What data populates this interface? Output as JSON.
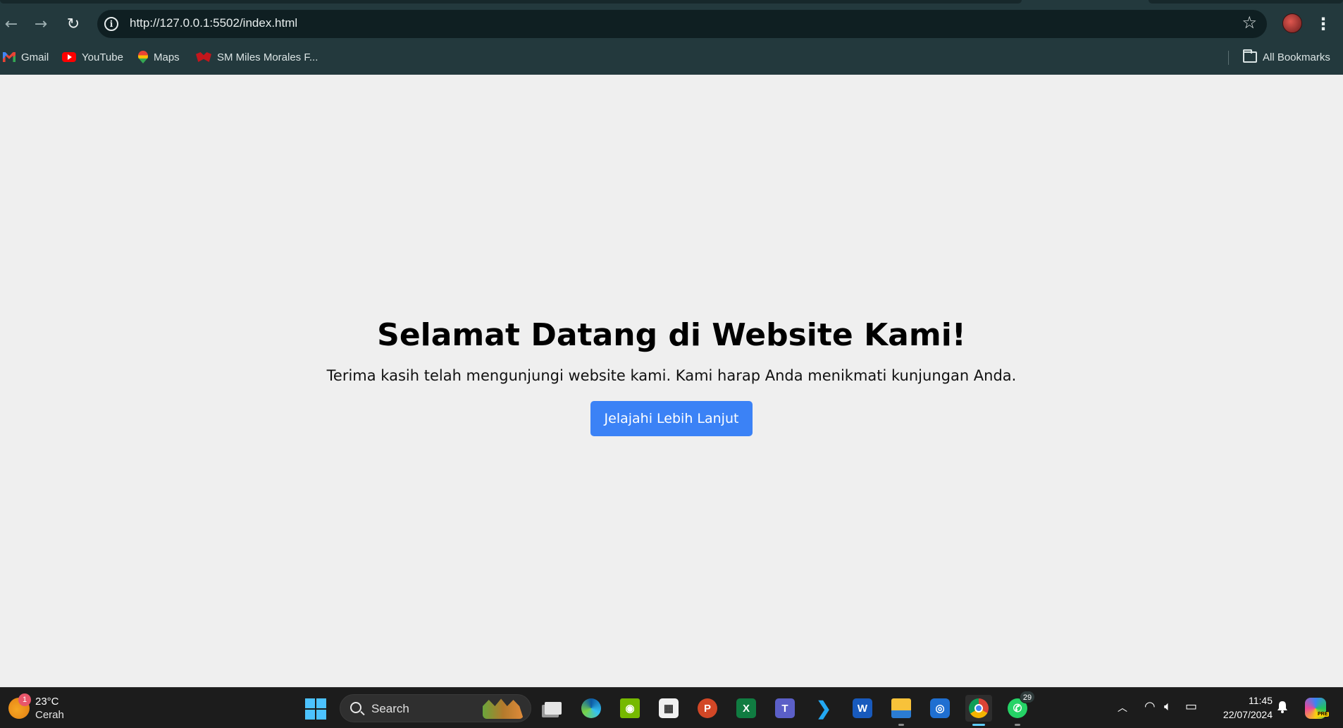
{
  "browser": {
    "url": "http://127.0.0.1:5502/index.html",
    "bookmarks": [
      {
        "label": "Gmail",
        "icon": "gmail-icon"
      },
      {
        "label": "YouTube",
        "icon": "youtube-icon"
      },
      {
        "label": "Maps",
        "icon": "maps-icon"
      },
      {
        "label": "SM Miles Morales F...",
        "icon": "spiderman-icon"
      }
    ],
    "all_bookmarks_label": "All Bookmarks"
  },
  "page": {
    "title": "Selamat Datang di Website Kami!",
    "subtitle": "Terima kasih telah mengunjungi website kami. Kami harap Anda menikmati kunjungan Anda.",
    "button_label": "Jelajahi Lebih Lanjut",
    "button_color": "#3b82f6",
    "background_color": "#efefef"
  },
  "taskbar": {
    "weather": {
      "temperature": "23°C",
      "condition": "Cerah",
      "badge": "1"
    },
    "search_label": "Search",
    "whatsapp_badge": "29",
    "apps": [
      "start-menu",
      "search",
      "task-view",
      "edge",
      "nvidia",
      "microsoft-store",
      "powerpoint",
      "excel",
      "teams",
      "vscode",
      "word",
      "file-explorer",
      "snipping-tool",
      "chrome",
      "whatsapp"
    ],
    "clock": {
      "time": "11:45",
      "date": "22/07/2024"
    },
    "copilot_tag": "PRE"
  }
}
